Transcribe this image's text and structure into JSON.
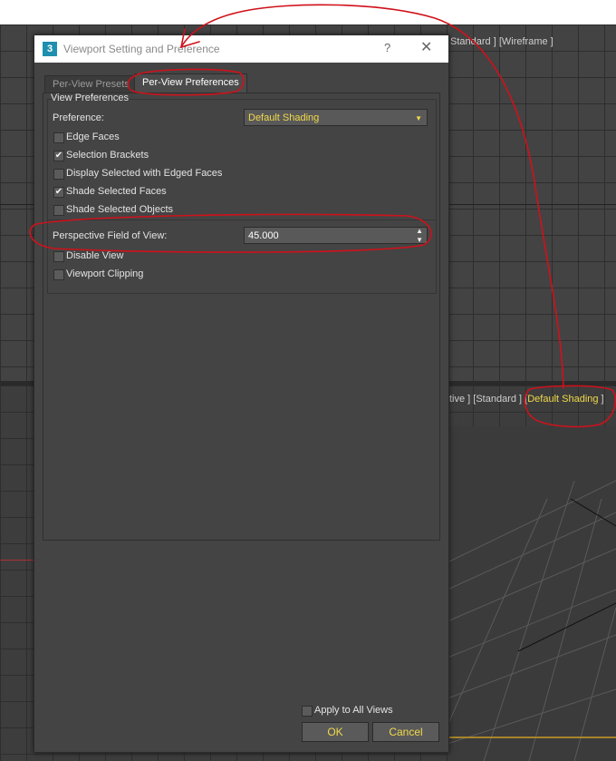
{
  "viewports": {
    "top_caption": "Standard ] [Wireframe ]",
    "bottom_caption_prefix": "tive ] [Standard ] [",
    "bottom_caption_highlight": "Default Shading",
    "bottom_caption_suffix": " ]"
  },
  "dialog": {
    "app_icon": "3",
    "title": "Viewport Setting and Preference",
    "help_label": "?",
    "close_label": "✕",
    "tabs": [
      {
        "label": "Per-View Presets"
      },
      {
        "label": "Per-View Preferences"
      }
    ],
    "group_title": "View Preferences",
    "preference_label": "Preference:",
    "preference_value": "Default Shading",
    "checkboxes": [
      {
        "label": "Edge Faces",
        "checked": false
      },
      {
        "label": "Selection Brackets",
        "checked": true
      },
      {
        "label": "Display Selected with Edged Faces",
        "checked": false
      },
      {
        "label": "Shade Selected Faces",
        "checked": true
      },
      {
        "label": "Shade Selected Objects",
        "checked": false
      }
    ],
    "fov_label": "Perspective Field of View:",
    "fov_value": "45.000",
    "extra_checkboxes": [
      {
        "label": "Disable View",
        "checked": false
      },
      {
        "label": "Viewport Clipping",
        "checked": false
      }
    ],
    "apply_all_label": "Apply to All Views",
    "ok_label": "OK",
    "cancel_label": "Cancel"
  },
  "colors": {
    "accent_yellow": "#f1d94a",
    "annotation_red": "#d0111b",
    "dialog_bg": "#444444"
  }
}
